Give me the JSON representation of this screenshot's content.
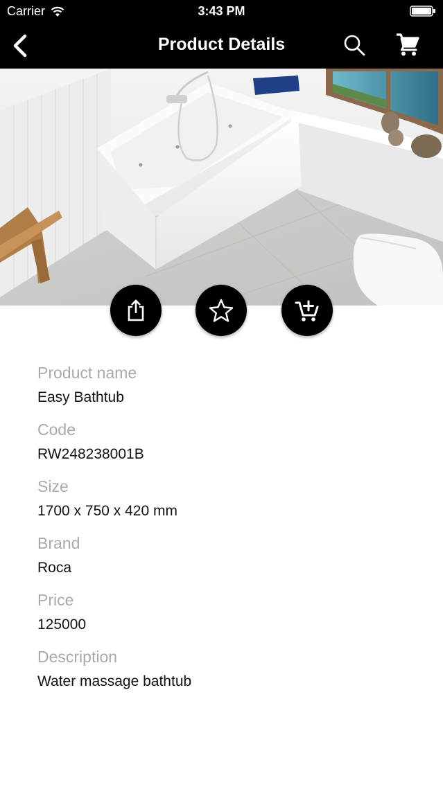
{
  "status_bar": {
    "carrier": "Carrier",
    "time": "3:43 PM",
    "icons": [
      "wifi-icon",
      "battery-icon"
    ]
  },
  "nav": {
    "title": "Product Details",
    "icons": [
      "back-chevron-icon",
      "search-icon",
      "cart-icon"
    ]
  },
  "gallery": {
    "page_count": 1,
    "current_page": 1
  },
  "actions": {
    "icons": [
      "share-icon",
      "star-icon",
      "add-to-cart-icon"
    ]
  },
  "product": {
    "fields": [
      {
        "label": "Product name",
        "value": "Easy Bathtub"
      },
      {
        "label": "Code",
        "value": "RW248238001B"
      },
      {
        "label": "Size",
        "value": "1700 x 750 x 420 mm"
      },
      {
        "label": "Brand",
        "value": "Roca"
      },
      {
        "label": "Price",
        "value": "125000"
      },
      {
        "label": "Description",
        "value": "Water massage bathtub"
      }
    ]
  },
  "colors": {
    "bar_background": "#000000",
    "bar_text": "#ffffff",
    "label_text": "#a9a9a9",
    "value_text": "#111111"
  }
}
